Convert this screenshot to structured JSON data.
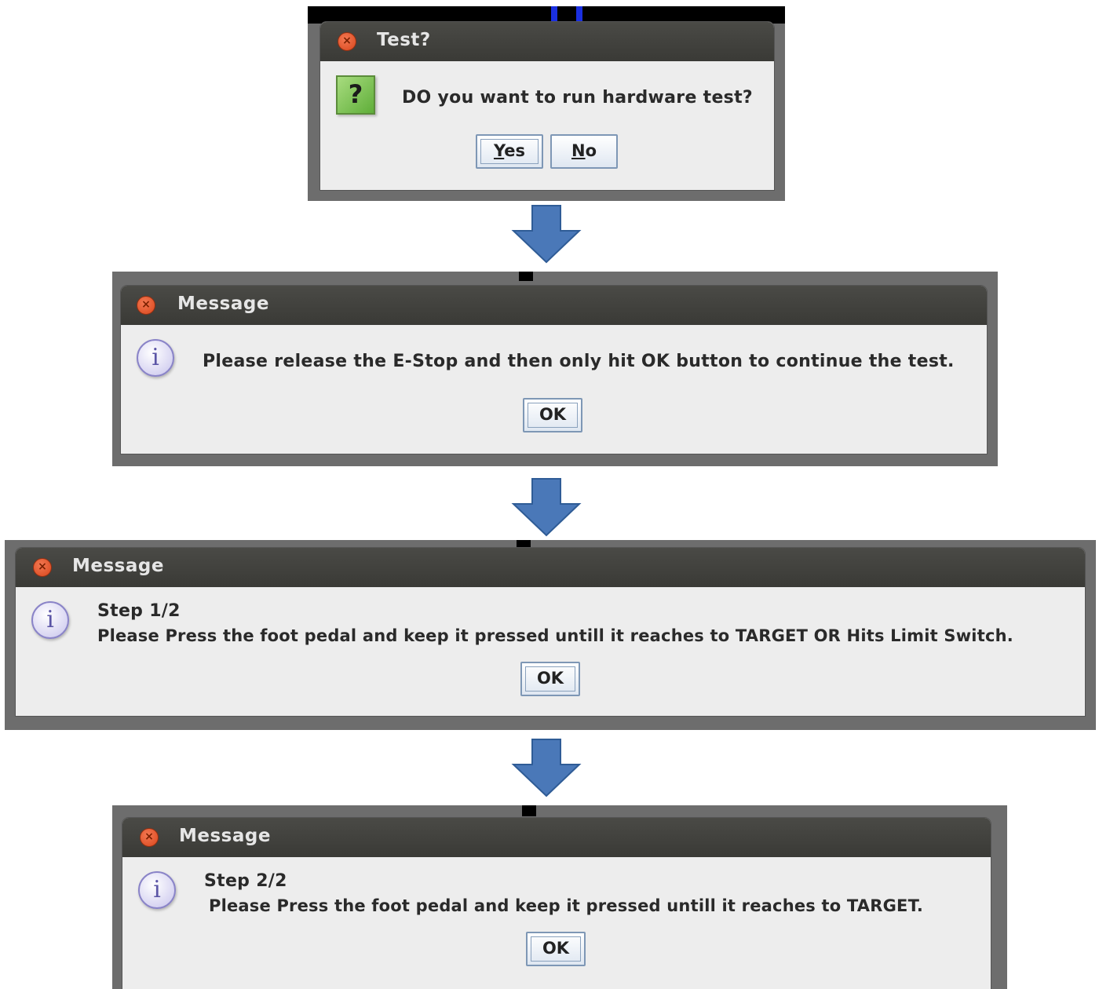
{
  "dialogs": [
    {
      "title": "Test?",
      "icon": "question-icon",
      "message": "DO you want to run hardware test?",
      "buttons": [
        {
          "label_mnemonic": "Y",
          "label_rest": "es"
        },
        {
          "label_mnemonic": "N",
          "label_rest": "o"
        }
      ]
    },
    {
      "title": "Message",
      "icon": "info-icon",
      "message": "Please release the E-Stop and then only hit OK button to continue the test.",
      "ok_label": "OK"
    },
    {
      "title": "Message",
      "icon": "info-icon",
      "message_line1": "Step 1/2",
      "message_line2": "Please Press the foot pedal and keep it pressed untill it reaches to TARGET OR Hits Limit Switch.",
      "ok_label": "OK"
    },
    {
      "title": "Message",
      "icon": "info-icon",
      "message_line1": "Step 2/2",
      "message_line2": "Please Press the foot pedal and keep it pressed untill it reaches to TARGET.",
      "ok_label": "OK"
    }
  ],
  "close_glyph": "×",
  "question_glyph": "?",
  "info_glyph": "i",
  "colors": {
    "titlebar": "#3d3d39",
    "dialog_bg": "#ededed",
    "arrow_fill": "#4a78b8",
    "arrow_stroke": "#2f5c96",
    "close_button": "#e55a2b"
  }
}
